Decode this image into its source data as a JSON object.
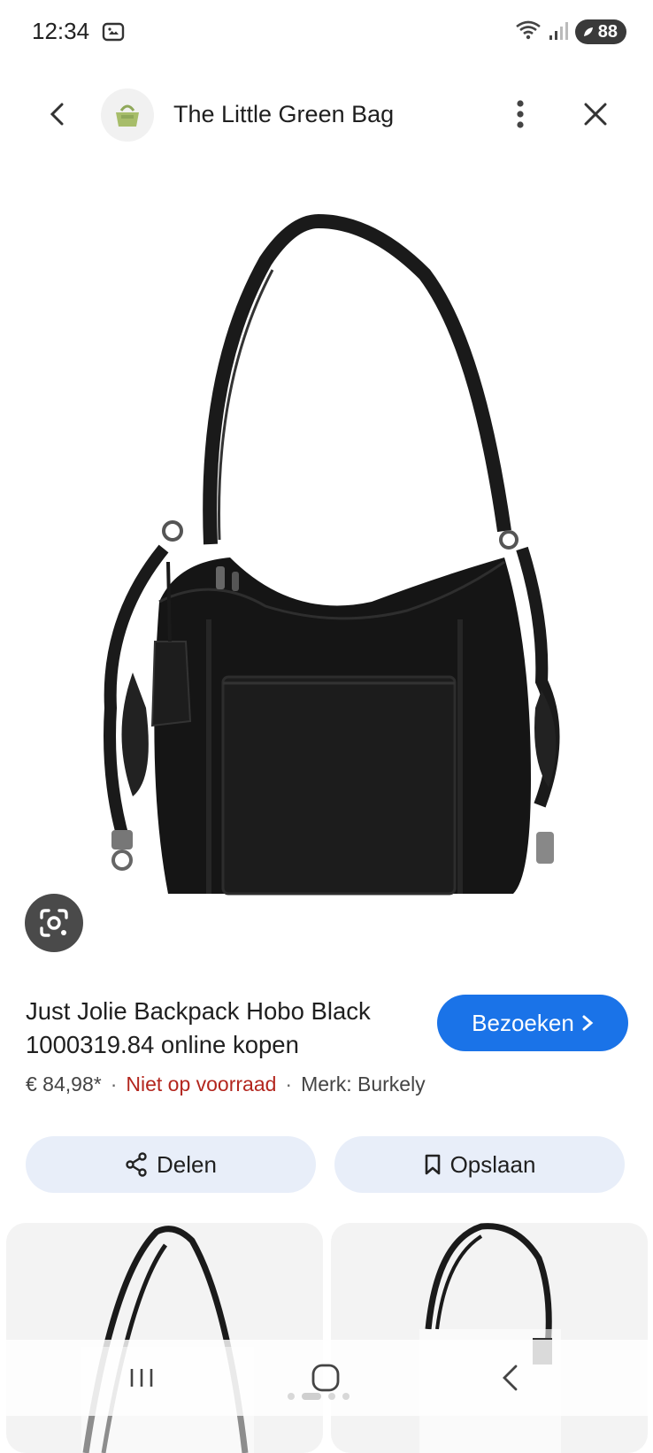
{
  "status_bar": {
    "time": "12:34",
    "battery": "88",
    "icons": [
      "screenshot-icon",
      "wifi-icon",
      "signal-icon",
      "battery-icon"
    ]
  },
  "header": {
    "site_title": "The Little Green Bag",
    "icons": [
      "back-arrow-icon",
      "bag-logo-icon",
      "more-vert-icon",
      "close-icon"
    ]
  },
  "product": {
    "title": "Just Jolie Backpack Hobo Black 1000319.84 online kopen",
    "visit_label": "Bezoeken",
    "price": "€ 84,98*",
    "stock": "Niet op voorraad",
    "brand": "Merk: Burkely",
    "separator": "·"
  },
  "actions": {
    "share_label": "Delen",
    "save_label": "Opslaan"
  },
  "colors": {
    "accent": "#1a73e8",
    "stock_out": "#b3261e",
    "chip_bg": "#e8eef9"
  },
  "nav_icons": [
    "recents-icon",
    "home-icon",
    "back-nav-icon"
  ]
}
